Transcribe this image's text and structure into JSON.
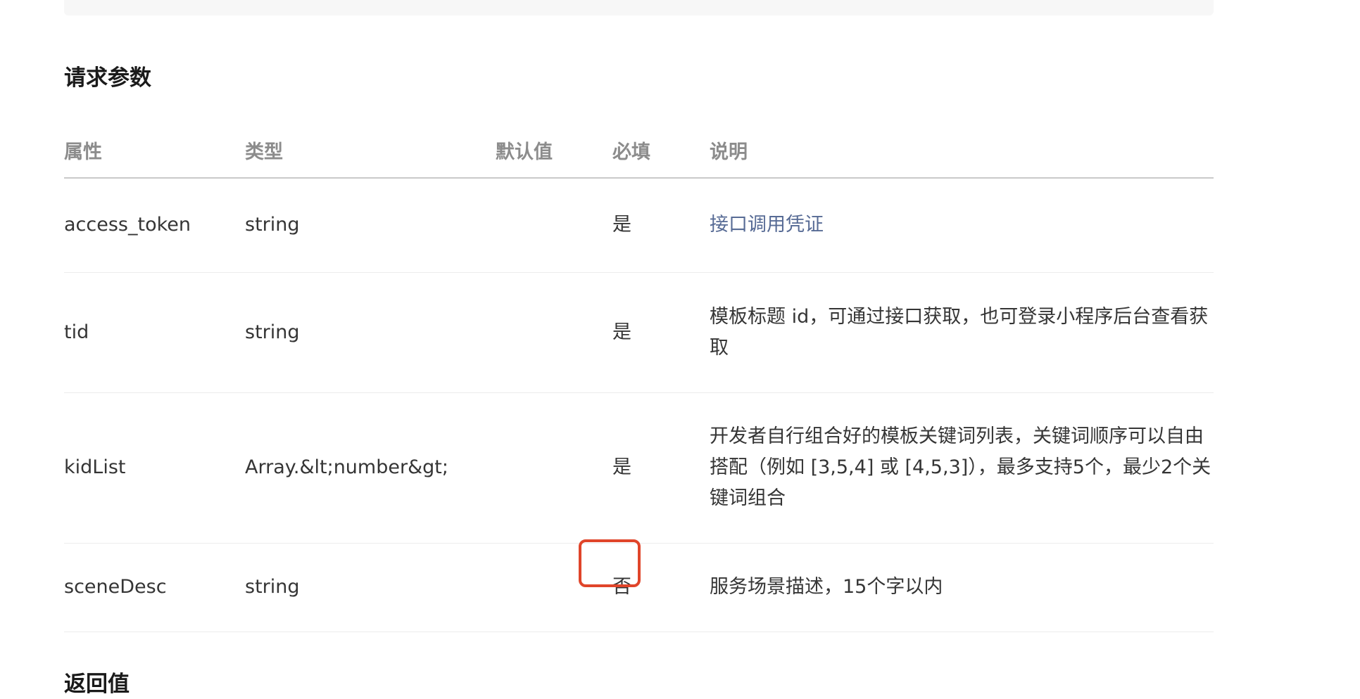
{
  "section": {
    "title": "请求参数"
  },
  "table": {
    "headers": {
      "attr": "属性",
      "type": "类型",
      "default": "默认值",
      "required": "必填",
      "desc": "说明"
    },
    "rows": [
      {
        "attr": "access_token",
        "type": "string",
        "default": "",
        "required": "是",
        "desc": "接口调用凭证",
        "desc_is_link": true
      },
      {
        "attr": "tid",
        "type": "string",
        "default": "",
        "required": "是",
        "desc": "模板标题 id，可通过接口获取，也可登录小程序后台查看获取"
      },
      {
        "attr": "kidList",
        "type": "Array.&lt;number&gt;",
        "default": "",
        "required": "是",
        "desc": "开发者自行组合好的模板关键词列表，关键词顺序可以自由搭配（例如 [3,5,4] 或 [4,5,3]），最多支持5个，最少2个关键词组合"
      },
      {
        "attr": "sceneDesc",
        "type": "string",
        "default": "",
        "required": "否",
        "desc": "服务场景描述，15个字以内",
        "required_highlighted": true
      }
    ]
  },
  "next_section": {
    "title": "返回值"
  },
  "colors": {
    "link": "#576b95",
    "highlight_border": "#e0452a",
    "header_text": "#8c8c8c",
    "body_text": "#353535"
  }
}
